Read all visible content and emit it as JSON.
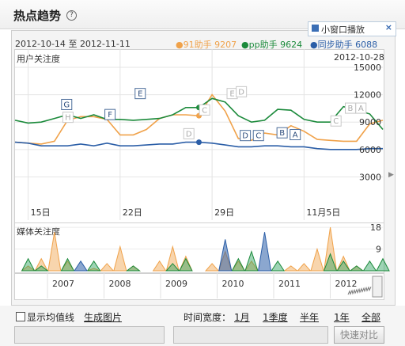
{
  "header": {
    "title": "热点趋势",
    "help_icon": "?"
  },
  "date_range": {
    "start": "2012-10-14",
    "sep": "至",
    "end": "2012-11-11"
  },
  "popup": {
    "label": "小窗口播放",
    "close": "×"
  },
  "legend": [
    {
      "name": "91助手",
      "value": "9207",
      "color": "#f0a24a"
    },
    {
      "name": "pp助手",
      "value": "9624",
      "color": "#1b8a3b"
    },
    {
      "name": "同步助手",
      "value": "6088",
      "color": "#2b5ea7"
    }
  ],
  "main_chart": {
    "ylabel": "用户关注度",
    "current_date": "2012-10-28",
    "yticks": [
      "15000",
      "12000",
      "9000",
      "6000",
      "3000"
    ],
    "xticks": [
      "15日",
      "22日",
      "29日",
      "11月5日"
    ]
  },
  "media_chart": {
    "ylabel": "媒体关注度",
    "yticks": [
      "18",
      "9"
    ]
  },
  "navigator": {
    "years": [
      "2007",
      "2008",
      "2009",
      "2010",
      "2011",
      "2012"
    ]
  },
  "event_markers": [
    "H",
    "G",
    "F",
    "E",
    "D",
    "C",
    "B",
    "A"
  ],
  "footer": {
    "show_avg": "显示均值线",
    "gen_image": "生成图片",
    "time_width_label": "时间宽度：",
    "periods": [
      "1月",
      "1季度",
      "半年",
      "1年",
      "全部"
    ],
    "compare_button": "快速对比"
  },
  "chart_data": {
    "type": "line",
    "x": [
      "10-14",
      "10-15",
      "10-16",
      "10-17",
      "10-18",
      "10-19",
      "10-20",
      "10-21",
      "10-22",
      "10-23",
      "10-24",
      "10-25",
      "10-26",
      "10-27",
      "10-28",
      "10-29",
      "10-30",
      "10-31",
      "11-01",
      "11-02",
      "11-03",
      "11-04",
      "11-05",
      "11-06",
      "11-07",
      "11-08",
      "11-09",
      "11-10",
      "11-11"
    ],
    "series": [
      {
        "name": "91助手",
        "values": [
          6800,
          6700,
          6600,
          6900,
          9200,
          9600,
          9600,
          9300,
          7600,
          7600,
          8200,
          9400,
          9800,
          9800,
          9700,
          12000,
          10200,
          7200,
          7000,
          7800,
          7600,
          8600,
          8000,
          7100,
          7000,
          6900,
          6900,
          8800,
          9200
        ]
      },
      {
        "name": "pp助手",
        "values": [
          9200,
          8900,
          9000,
          9400,
          9800,
          9400,
          9800,
          9300,
          9300,
          9200,
          9300,
          9400,
          9800,
          10600,
          10600,
          11600,
          11200,
          9700,
          9000,
          9200,
          10400,
          10300,
          9300,
          9000,
          9000,
          10700,
          10300,
          9900,
          8200
        ]
      },
      {
        "name": "同步助手",
        "values": [
          6800,
          6700,
          6400,
          6400,
          6400,
          6600,
          6400,
          6700,
          6400,
          6400,
          6500,
          6600,
          6600,
          6800,
          6800,
          6700,
          6500,
          6300,
          6300,
          6400,
          6400,
          6300,
          6300,
          6100,
          6000,
          6000,
          6000,
          6100,
          6100
        ]
      }
    ],
    "ylim": [
      0,
      17000
    ],
    "yticks": [
      3000,
      6000,
      9000,
      12000,
      15000
    ],
    "media_series": [
      {
        "name": "91助手",
        "values": [
          0,
          2,
          5,
          16,
          4,
          0,
          1,
          3,
          10,
          2,
          0,
          4,
          10,
          6,
          0,
          3,
          8,
          4,
          4,
          0,
          0,
          2,
          3,
          9,
          18,
          6,
          2,
          0,
          0
        ]
      },
      {
        "name": "pp助手",
        "values": [
          0,
          5,
          2,
          0,
          5,
          0,
          4,
          0,
          0,
          2,
          0,
          0,
          3,
          5,
          0,
          0,
          0,
          5,
          8,
          0,
          4,
          0,
          0,
          0,
          7,
          4,
          2,
          4,
          5
        ]
      },
      {
        "name": "同步助手",
        "values": [
          0,
          0,
          0,
          0,
          0,
          4,
          0,
          0,
          0,
          0,
          0,
          0,
          0,
          0,
          0,
          0,
          13,
          0,
          0,
          16,
          0,
          0,
          0,
          0,
          0,
          0,
          0,
          0,
          0
        ]
      }
    ],
    "media_ylim": [
      0,
      20
    ]
  }
}
